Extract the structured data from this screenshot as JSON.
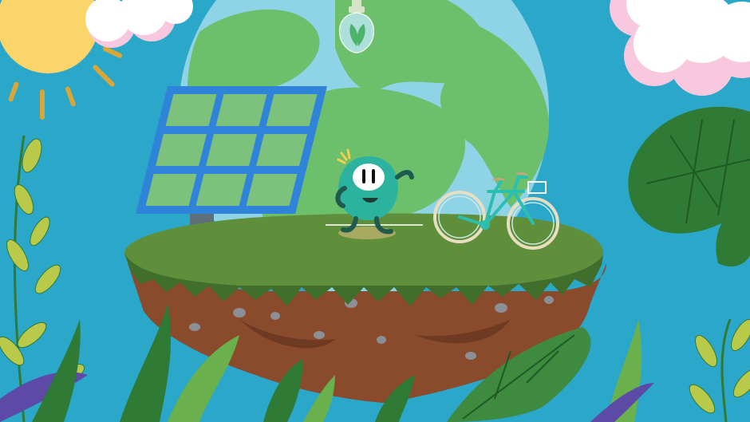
{
  "scene": {
    "description_visible_text": "",
    "colors": {
      "sky": "#2aa7c9",
      "globe_ocean": "#8fd3e6",
      "globe_land": "#6cc06b",
      "sun": "#fbd46a",
      "sun_rays": "#d9a63a",
      "cloud": "#ffffff",
      "cloud_shadow": "#f8c9de",
      "solar_panel_frame": "#2f84d9",
      "solar_panel_cell": "#7cc27c",
      "panel_stand": "#5f6f7a",
      "grass": "#5f8f3b",
      "grass_dark": "#3f6f2a",
      "soil": "#8a4a2c",
      "soil_dark": "#6e3a22",
      "rock": "#8c8f96",
      "mascot_body": "#2bb3a0",
      "mascot_face": "#ffffff",
      "bicycle": "#2cbfb0",
      "leaf_dark": "#2f7a35",
      "leaf_light": "#6ab04c",
      "leaf_yellow": "#b9c94a",
      "purple_leaf": "#5d4aa7"
    },
    "icons": [
      "sun-icon",
      "cloud-icon",
      "globe-icon",
      "light-bulb-icon",
      "solar-panel-icon",
      "mascot-character-icon",
      "bicycle-icon",
      "floating-island-icon",
      "monstera-leaf-icon",
      "fern-leaf-icon"
    ]
  }
}
